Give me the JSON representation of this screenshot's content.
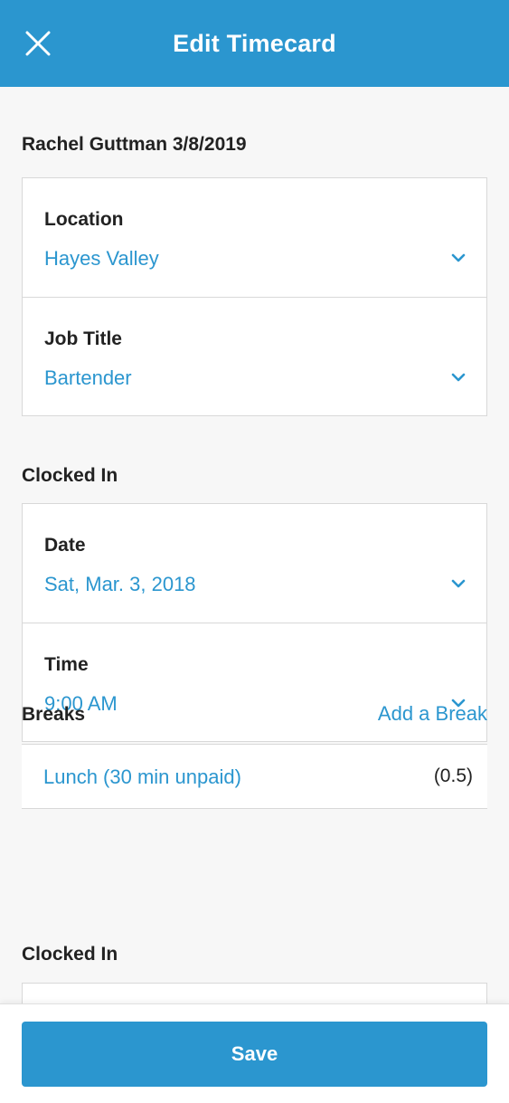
{
  "header": {
    "title": "Edit Timecard",
    "close_icon": "close-icon"
  },
  "employee": {
    "heading": "Rachel Guttman 3/8/2019"
  },
  "assignment": {
    "location": {
      "label": "Location",
      "value": "Hayes Valley"
    },
    "job_title": {
      "label": "Job Title",
      "value": "Bartender"
    }
  },
  "clocked_in": {
    "title": "Clocked In",
    "date": {
      "label": "Date",
      "value": "Sat, Mar. 3, 2018"
    },
    "time": {
      "label": "Time",
      "value": "9:00 AM"
    }
  },
  "breaks": {
    "title": "Breaks",
    "add_label": "Add a Break",
    "items": [
      {
        "name": "Lunch (30 min unpaid)",
        "hours": "(0.5)"
      }
    ]
  },
  "clocked_out_partial": {
    "title": "Clocked In"
  },
  "footer": {
    "save_label": "Save"
  },
  "colors": {
    "accent": "#2b96cf",
    "background": "#f7f7f7",
    "border": "#d8d8d8"
  }
}
